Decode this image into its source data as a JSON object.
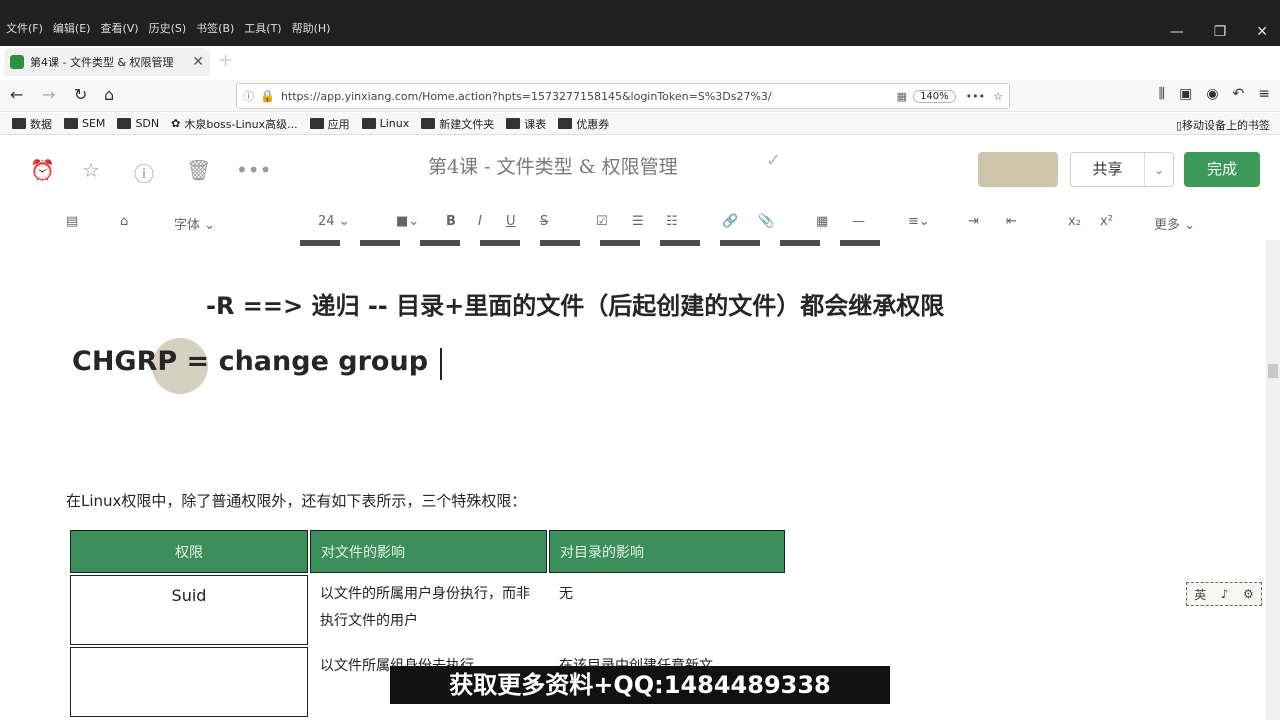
{
  "menubar": {
    "items": [
      "文件(F)",
      "编辑(E)",
      "查看(V)",
      "历史(S)",
      "书签(B)",
      "工具(T)",
      "帮助(H)"
    ]
  },
  "tab": {
    "title": "第4课 - 文件类型 & 权限管理"
  },
  "address": {
    "url": "https://app.yinxiang.com/Home.action?hpts=1573277158145&loginToken=S%3Ds27%3/",
    "zoom": "140%"
  },
  "bookmarks": {
    "items": [
      "数据",
      "SEM",
      "SDN",
      "木泉boss-Linux高级...",
      "应用",
      "Linux",
      "新建文件夹",
      "课表",
      "优惠券"
    ],
    "mobile": "移动设备上的书签"
  },
  "note": {
    "title": "第4课 - 文件类型 & 权限管理",
    "share_label": "共享",
    "done_label": "完成"
  },
  "format": {
    "font_label": "字体",
    "size_label": "24",
    "more_label": "更多"
  },
  "content": {
    "line_r": "-R  ==> 递归 -- 目录+里面的文件（后起创建的文件）都会继承权限",
    "line_chgrp": "CHGRP = change group",
    "paragraph": "在Linux权限中，除了普通权限外，还有如下表所示，三个特殊权限：",
    "table": {
      "headers": [
        "权限",
        "对文件的影响",
        "对目录的影响"
      ],
      "rows": [
        [
          "Suid",
          "以文件的所属用户身份执行，而非执行文件的用户",
          "无"
        ],
        [
          "",
          "以文件所属组身份去执行",
          "在该目录中创建任意新文"
        ]
      ]
    }
  },
  "ime": {
    "items": [
      "英",
      "♪",
      "⚙"
    ]
  },
  "banner": {
    "text": "获取更多资料+QQ:1484489338"
  }
}
